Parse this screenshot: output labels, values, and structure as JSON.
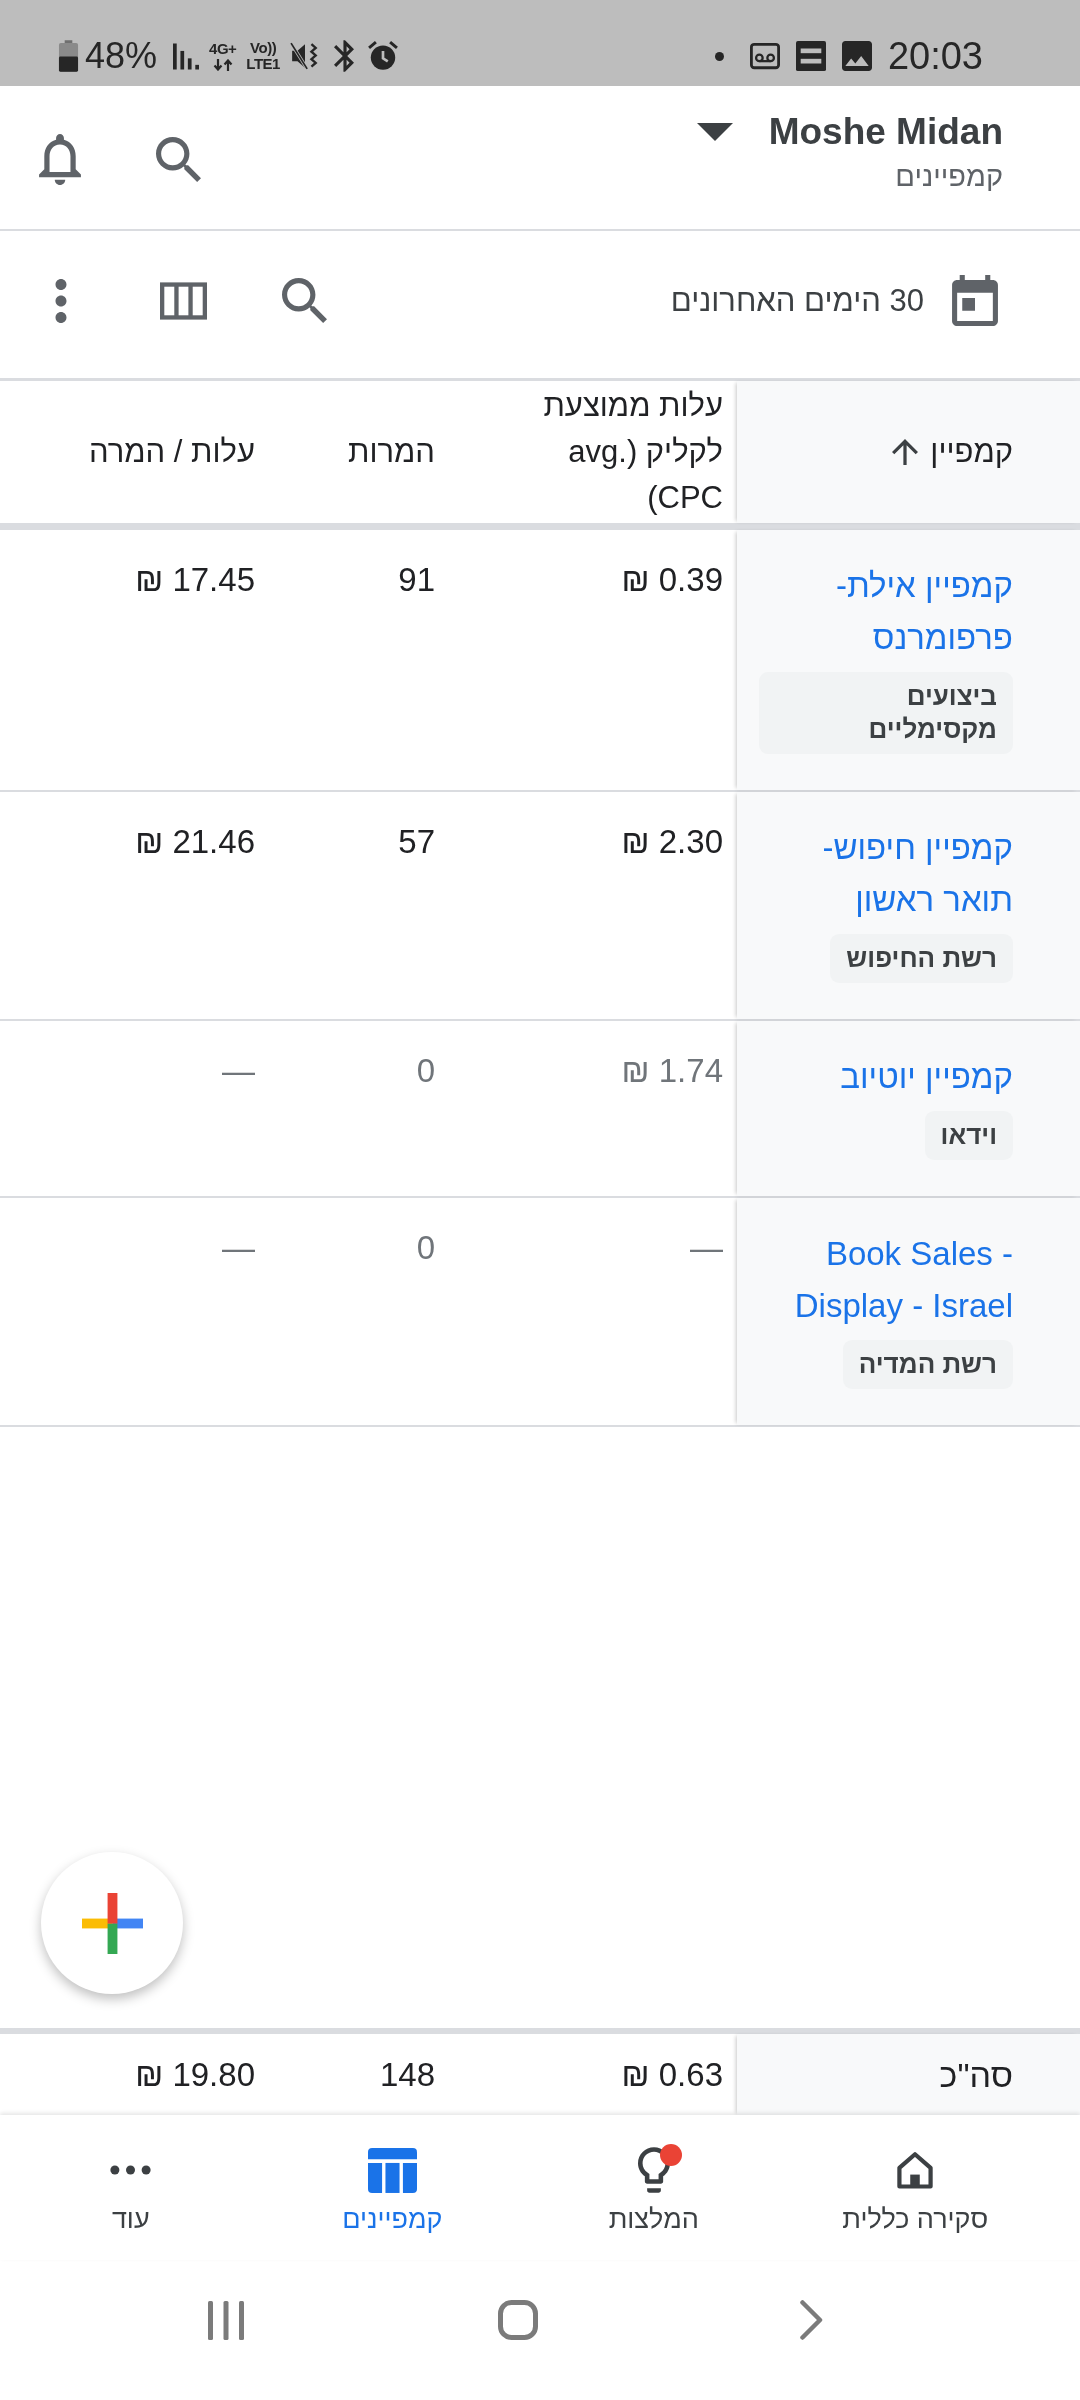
{
  "status_bar": {
    "battery": "48%",
    "network": "4G+",
    "volte": "Vo))",
    "volte_sub": "LTE1",
    "time": "20:03"
  },
  "header": {
    "account": "Moshe Midan",
    "subtitle": "קמפיינים"
  },
  "toolbar": {
    "date_range": "30 הימים האחרונים"
  },
  "table": {
    "columns": [
      {
        "label": "קמפיין",
        "sorted": true
      },
      {
        "label": "עלות ממוצעת לקליק (avg. CPC)",
        "sorted": false
      },
      {
        "label": "המרות",
        "sorted": false
      },
      {
        "label": "עלות / המרה",
        "sorted": false
      }
    ],
    "rows": [
      {
        "campaign": "קמפיין אילת-פרפומרנס",
        "type": "ביצועים מקסימליים",
        "avg_cpc": "0.39 ₪",
        "conversions": "91",
        "cost_per_conversion": "17.45 ₪",
        "dimmed": false
      },
      {
        "campaign": "קמפיין חיפוש-תואר ראשון",
        "type": "רשת החיפוש",
        "avg_cpc": "2.30 ₪",
        "conversions": "57",
        "cost_per_conversion": "21.46 ₪",
        "dimmed": false
      },
      {
        "campaign": "קמפיין יוטיוב",
        "type": "וידאו",
        "avg_cpc": "1.74 ₪",
        "conversions": "0",
        "cost_per_conversion": "—",
        "dimmed": true
      },
      {
        "campaign": "Book Sales - Display - Israel",
        "type": "רשת המדיה",
        "avg_cpc": "—",
        "conversions": "0",
        "cost_per_conversion": "—",
        "dimmed": true
      }
    ],
    "total": {
      "label": "סה\"כ",
      "avg_cpc": "0.63 ₪",
      "conversions": "148",
      "cost_per_conversion": "19.80 ₪"
    }
  },
  "bottom_nav": [
    {
      "label": "סקירה כללית",
      "selected": false,
      "badge": false
    },
    {
      "label": "המלצות",
      "selected": false,
      "badge": true
    },
    {
      "label": "קמפיינים",
      "selected": true,
      "badge": false
    },
    {
      "label": "עוד",
      "selected": false,
      "badge": false
    }
  ]
}
